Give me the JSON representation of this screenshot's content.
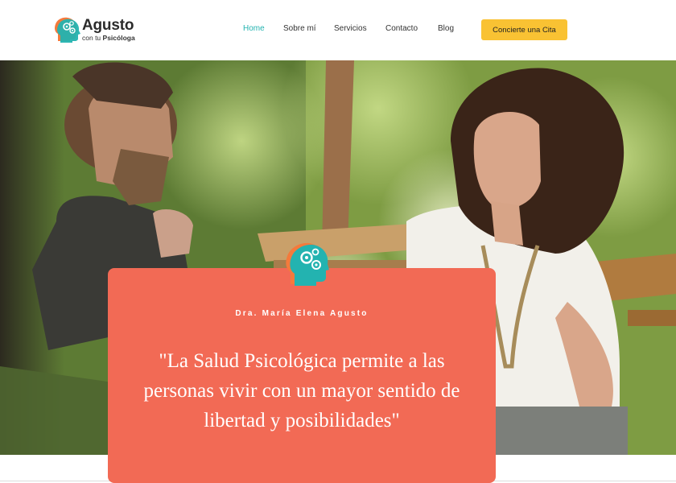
{
  "header": {
    "logo": {
      "title": "Agusto",
      "subtitle_prefix": "con tu",
      "subtitle_strong": "Psicóloga",
      "icon": "head-gears-icon"
    },
    "nav": [
      {
        "label": "Home",
        "active": true
      },
      {
        "label": "Sobre mí",
        "active": false
      },
      {
        "label": "Servicios",
        "active": false
      },
      {
        "label": "Contacto",
        "active": false
      },
      {
        "label": "Blog",
        "active": false
      }
    ],
    "cta_label": "Concierte una Cita"
  },
  "hero": {
    "photo_icon": "counseling-photo",
    "card": {
      "icon": "head-gears-icon",
      "name": "Dra. María Elena Agusto",
      "quote": "\"La Salud Psicológica permite a las personas vivir con un mayor sentido de libertad y posibilidades\""
    }
  },
  "colors": {
    "accent_teal": "#23b3b0",
    "cta_yellow": "#f9c233",
    "card_coral": "#f26a55",
    "logo_orange": "#f47a3c"
  }
}
